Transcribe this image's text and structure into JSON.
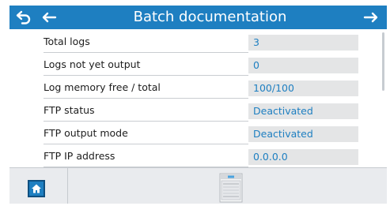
{
  "header": {
    "title": "Batch documentation",
    "back_icon": "back-return-icon",
    "prev_icon": "arrow-left-icon",
    "next_icon": "arrow-right-icon",
    "color": "#1e7fc1"
  },
  "rows": [
    {
      "label": "Total logs",
      "value": "3"
    },
    {
      "label": "Logs not yet output",
      "value": "0"
    },
    {
      "label": "Log memory free / total",
      "value": "100/100"
    },
    {
      "label": "FTP status",
      "value": "Deactivated"
    },
    {
      "label": "FTP output mode",
      "value": "Deactivated"
    },
    {
      "label": "FTP IP address",
      "value": "0.0.0.0"
    }
  ],
  "footer": {
    "home_icon": "home-icon",
    "device_icon": "washer-disinfector-icon"
  },
  "colors": {
    "accent": "#1e7fc1",
    "value_bg": "#e4e5e6",
    "footer_bg": "#e9ebee"
  }
}
